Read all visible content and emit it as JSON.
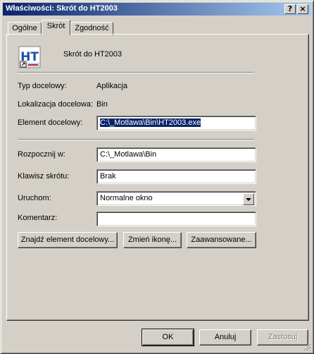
{
  "window": {
    "title": "Właściwości: Skrót do HT2003",
    "help_glyph": "?",
    "close_glyph": "×"
  },
  "tabs": [
    {
      "label": "Ogólne"
    },
    {
      "label": "Skrót"
    },
    {
      "label": "Zgodność"
    }
  ],
  "shortcut": {
    "icon_text": "HT",
    "name": "Skrót do HT2003"
  },
  "info": {
    "target_type_label": "Typ docelowy:",
    "target_type_value": "Aplikacja",
    "target_location_label": "Lokalizacja docelowa:",
    "target_location_value": "Bin",
    "target_label": "Element docelowy:",
    "target_value": "C:\\_Motlawa\\Bin\\HT2003.exe"
  },
  "fields": {
    "start_in_label": "Rozpocznij w:",
    "start_in_value": "C:\\_Motlawa\\Bin",
    "hotkey_label": "Klawisz skrótu:",
    "hotkey_value": "Brak",
    "run_label": "Uruchom:",
    "run_value": "Normalne okno",
    "comment_label": "Komentarz:",
    "comment_value": ""
  },
  "actions": {
    "find_target": "Znajdź element docelowy...",
    "change_icon": "Zmień ikonę...",
    "advanced": "Zaawansowane..."
  },
  "footer": {
    "ok": "OK",
    "cancel": "Anuluj",
    "apply": "Zastosuj"
  },
  "colors": {
    "title_gradient_start": "#0a246a",
    "title_gradient_end": "#a6caf0",
    "face": "#d4d0c8",
    "selection": "#0a246a"
  }
}
